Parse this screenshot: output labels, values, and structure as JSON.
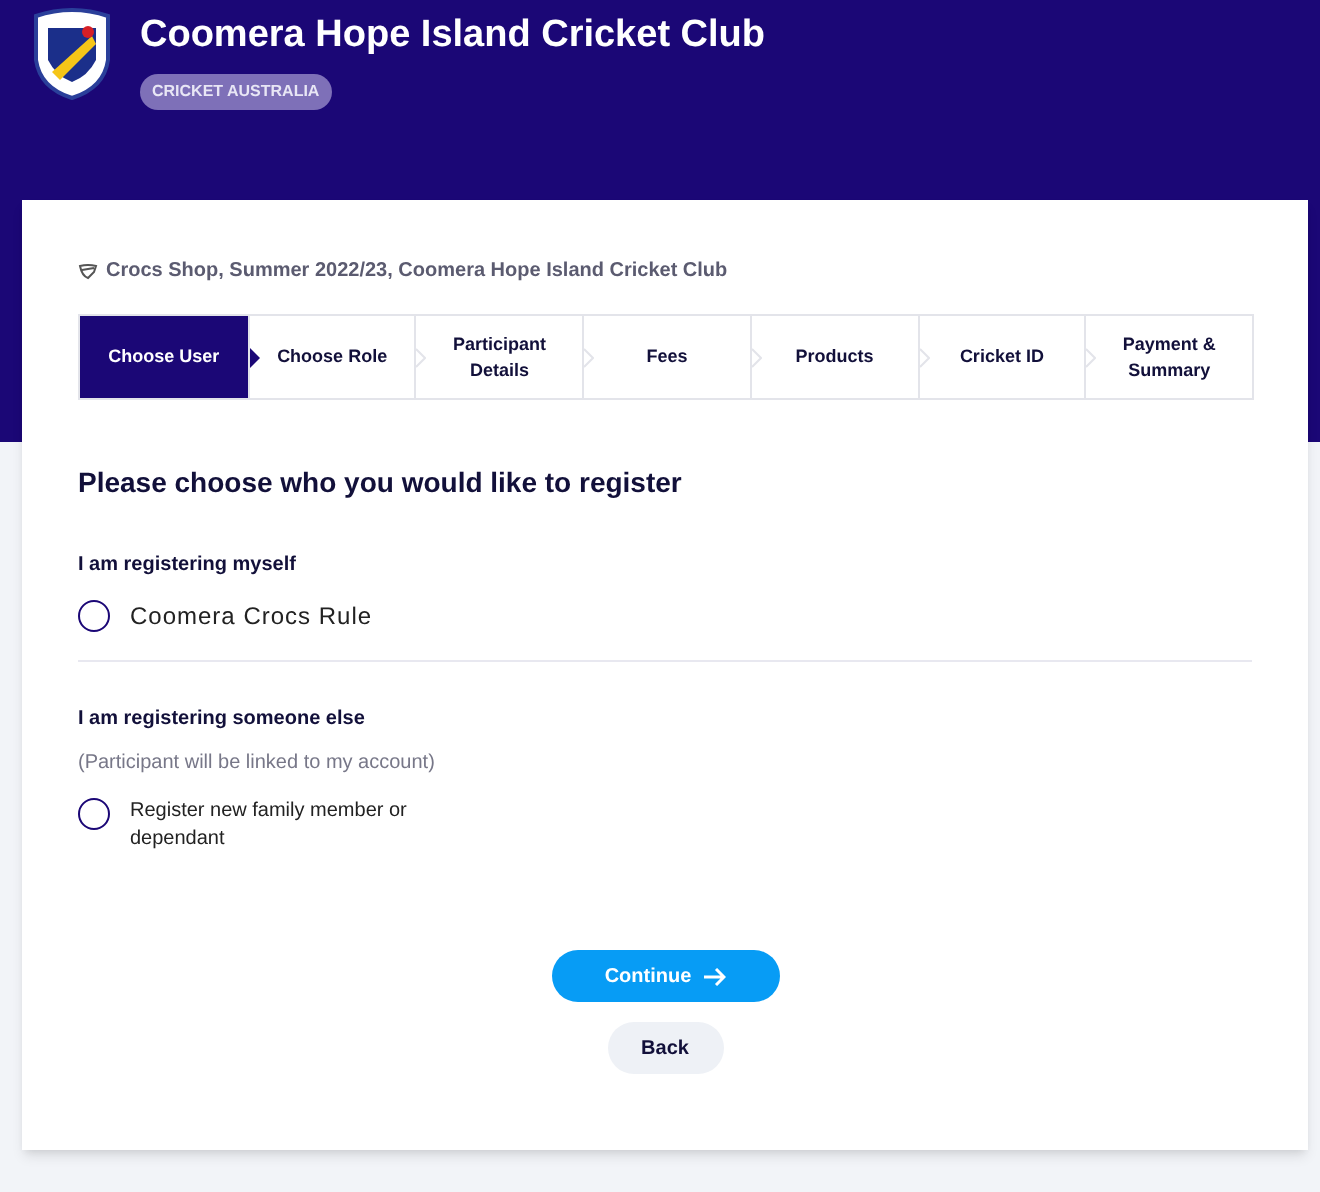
{
  "header": {
    "title": "Coomera Hope Island Cricket Club",
    "badge": "CRICKET AUSTRALIA"
  },
  "breadcrumb": "Crocs Shop, Summer 2022/23, Coomera Hope Island Cricket Club",
  "steps": [
    {
      "label": "Choose User",
      "selected": true
    },
    {
      "label": "Choose Role",
      "selected": false
    },
    {
      "label": "Participant Details",
      "selected": false
    },
    {
      "label": "Fees",
      "selected": false
    },
    {
      "label": "Products",
      "selected": false
    },
    {
      "label": "Cricket ID",
      "selected": false
    },
    {
      "label": "Payment & Summary",
      "selected": false
    }
  ],
  "heading": "Please choose who you would like to register",
  "groups": [
    {
      "label": "I am registering myself",
      "options": [
        {
          "label": "Coomera Crocs Rule",
          "selected": false
        }
      ]
    },
    {
      "label": "I am registering someone else",
      "note": "(Participant will be linked to my account)",
      "options": [
        {
          "label": "Register new family member or dependant",
          "selected": false
        }
      ]
    }
  ],
  "buttons": {
    "continue": "Continue",
    "back": "Back"
  }
}
